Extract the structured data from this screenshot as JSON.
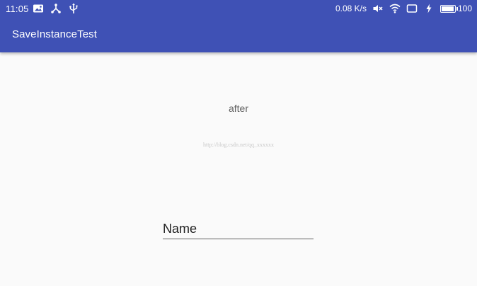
{
  "status_bar": {
    "time": "11:05",
    "left_icons": [
      "image-icon",
      "share-icon",
      "usb-icon"
    ],
    "network_speed": "0.08 K/s",
    "right_icons": [
      "mute-icon",
      "wifi-icon",
      "screen-icon",
      "charging-icon",
      "battery-icon"
    ],
    "battery_level": "100",
    "battery_fraction": 1.0
  },
  "app_bar": {
    "title": "SaveInstanceTest",
    "color": "#3f51b5"
  },
  "content": {
    "text": "after",
    "watermark": "http://blog.csdn.net/qq_xxxxxx"
  },
  "name_input": {
    "value": "Name",
    "underline_color": "#616161"
  }
}
